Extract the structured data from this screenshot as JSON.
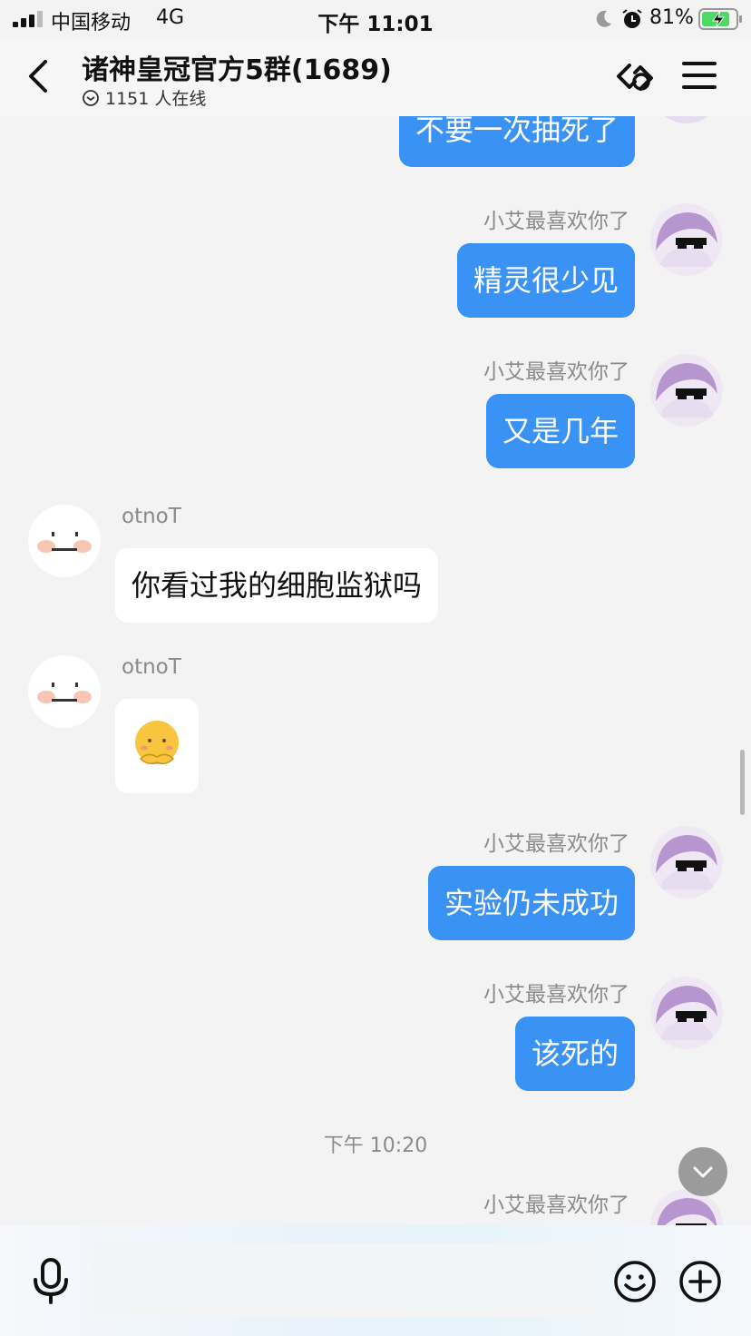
{
  "status_bar": {
    "carrier": "中国移动",
    "network": "4G",
    "time": "下午 11:01",
    "battery_percent": "81%"
  },
  "header": {
    "title": "诸神皇冠官方5群(1689)",
    "online_count": "1151 人在线"
  },
  "messages": [
    {
      "side": "right",
      "sender": "",
      "text": "不要一次抽死了"
    },
    {
      "side": "right",
      "sender": "小艾最喜欢你了",
      "text": "精灵很少见"
    },
    {
      "side": "right",
      "sender": "小艾最喜欢你了",
      "text": "又是几年"
    },
    {
      "side": "left",
      "sender": "otnoT",
      "text": "你看过我的细胞监狱吗"
    },
    {
      "side": "left",
      "sender": "otnoT",
      "sticker": "shy-face-sticker"
    },
    {
      "side": "right",
      "sender": "小艾最喜欢你了",
      "text": "实验仍未成功"
    },
    {
      "side": "right",
      "sender": "小艾最喜欢你了",
      "text": "该死的"
    },
    {
      "timestamp": "下午 10:20"
    },
    {
      "side": "right",
      "sender": "小艾最喜欢你了",
      "text": ""
    }
  ],
  "input": {
    "placeholder": ""
  },
  "colors": {
    "outgoing_bubble": "#3a92f4",
    "incoming_bubble": "#ffffff",
    "background": "#f3f3f4"
  },
  "icons": [
    "back-arrow-icon",
    "online-status-icon",
    "link-icon",
    "menu-icon",
    "mic-icon",
    "emoji-icon",
    "plus-icon",
    "chevron-down-icon"
  ]
}
